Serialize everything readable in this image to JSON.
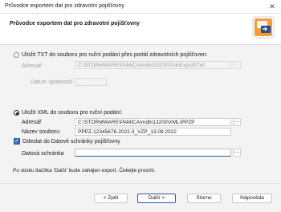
{
  "window": {
    "title": "Průvodce exportem dat pro zdravotní pojišťovny",
    "close_glyph": "✕"
  },
  "header": {
    "title": "Průvodce exportem dat pro zdravotní pojišťovny"
  },
  "option_txt": {
    "label": "Uložit TXT do souboru pro ruční podání přes portál zdravotních pojišťoven:",
    "checked": false,
    "address_label": "Adresář",
    "address_value": "C:\\STORMWARE\\PAMICA\\mdb\\13200\\Tisk\\Export\\Txt\\",
    "validity_label": "Datum splatnosti",
    "validity_value": ". .",
    "browse_glyph": "…"
  },
  "option_xml": {
    "label": "Uložit XML do souboru pro ruční podání:",
    "checked": true,
    "address_label": "Adresář",
    "address_value": "C:\\STORMWARE\\PAMICA\\mdb\\13200\\XML\\PPZP",
    "filename_label": "Název souboru",
    "filename_value": "PPPZ-12345678-2022-3_VZP_13.09.2022",
    "browse_glyph": "…"
  },
  "send_databox": {
    "label": "Odeslat do Datové schránky pojišťovny",
    "checked": true,
    "check_glyph": "✓",
    "field_label": "Datová schránka",
    "field_value": "",
    "browse_glyph": "…"
  },
  "info_text": "Po stisku tlačítka 'Další' bude zahájen export. Čekejte prosím.",
  "buttons": {
    "back": "< Zpět",
    "next": "Další >",
    "cancel": "Storno",
    "help": "Nápověda"
  }
}
